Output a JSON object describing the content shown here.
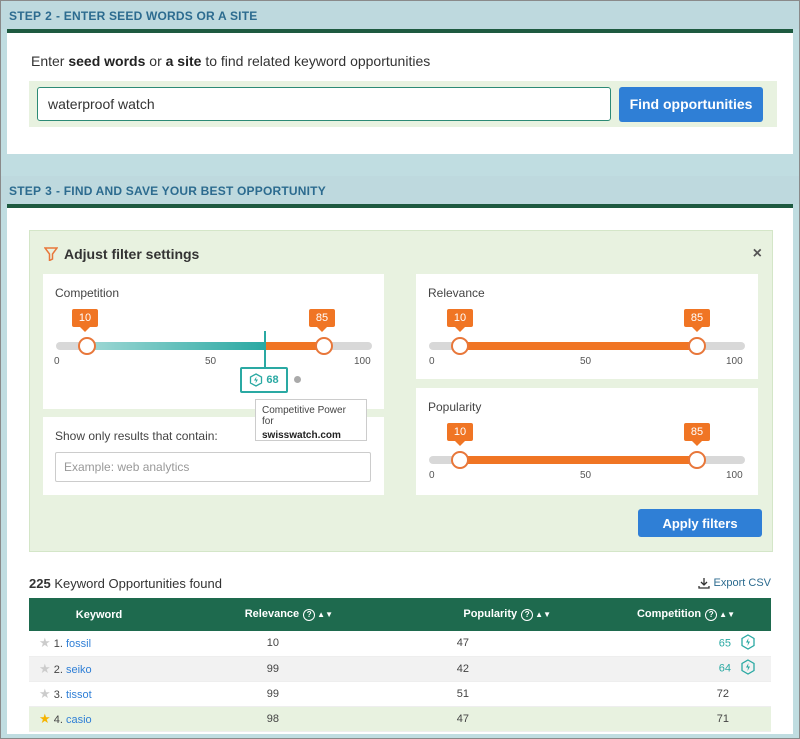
{
  "step2": {
    "label": "STEP",
    "number": "2",
    "title": "- ENTER SEED WORDS OR A SITE",
    "intro_pre": "Enter ",
    "intro_b1": "seed words",
    "intro_mid": " or ",
    "intro_b2": "a site",
    "intro_post": " to find related keyword opportunities",
    "seed_value": "waterproof watch",
    "find_button": "Find opportunities"
  },
  "step3": {
    "label": "STEP",
    "number": "3",
    "title": "- FIND AND SAVE YOUR BEST OPPORTUNITY"
  },
  "filters": {
    "title": "Adjust filter settings",
    "close": "×",
    "competition": {
      "label": "Competition",
      "min_value": "10",
      "max_value": "85",
      "min_frac": 0.1,
      "max_frac": 0.85,
      "ticks": [
        "0",
        "50",
        "100"
      ],
      "competitive_power": "68",
      "competitive_power_frac": 0.68
    },
    "tooltip": {
      "text": "Competitive Power for",
      "site": "swisswatch.com"
    },
    "relevance": {
      "label": "Relevance",
      "min_value": "10",
      "max_value": "85",
      "ticks": [
        "0",
        "50",
        "100"
      ]
    },
    "popularity": {
      "label": "Popularity",
      "min_value": "10",
      "max_value": "85",
      "ticks": [
        "0",
        "50",
        "100"
      ]
    },
    "contains": {
      "label": "Show only results that contain:",
      "placeholder": "Example: web analytics"
    },
    "apply_button": "Apply filters"
  },
  "results": {
    "count": "225",
    "count_label": " Keyword Opportunities found",
    "export": "Export CSV",
    "columns": [
      "Keyword",
      "Relevance",
      "Popularity",
      "Competition"
    ],
    "rows": [
      {
        "rank": "1.",
        "keyword": "fossil",
        "relevance": "10",
        "popularity": "47",
        "competition": "65",
        "starred": false,
        "link": true
      },
      {
        "rank": "2.",
        "keyword": "seiko",
        "relevance": "99",
        "popularity": "42",
        "competition": "64",
        "starred": false,
        "link": true
      },
      {
        "rank": "3.",
        "keyword": "tissot",
        "relevance": "99",
        "popularity": "51",
        "competition": "72",
        "starred": false,
        "link": false
      },
      {
        "rank": "4.",
        "keyword": "casio",
        "relevance": "98",
        "popularity": "47",
        "competition": "71",
        "starred": true,
        "link": false
      }
    ]
  },
  "colors": {
    "accent_orange": "#f07524",
    "teal": "#2aa9a3",
    "primary_blue": "#2f7fd6",
    "dark_green": "#1e6a4e"
  }
}
